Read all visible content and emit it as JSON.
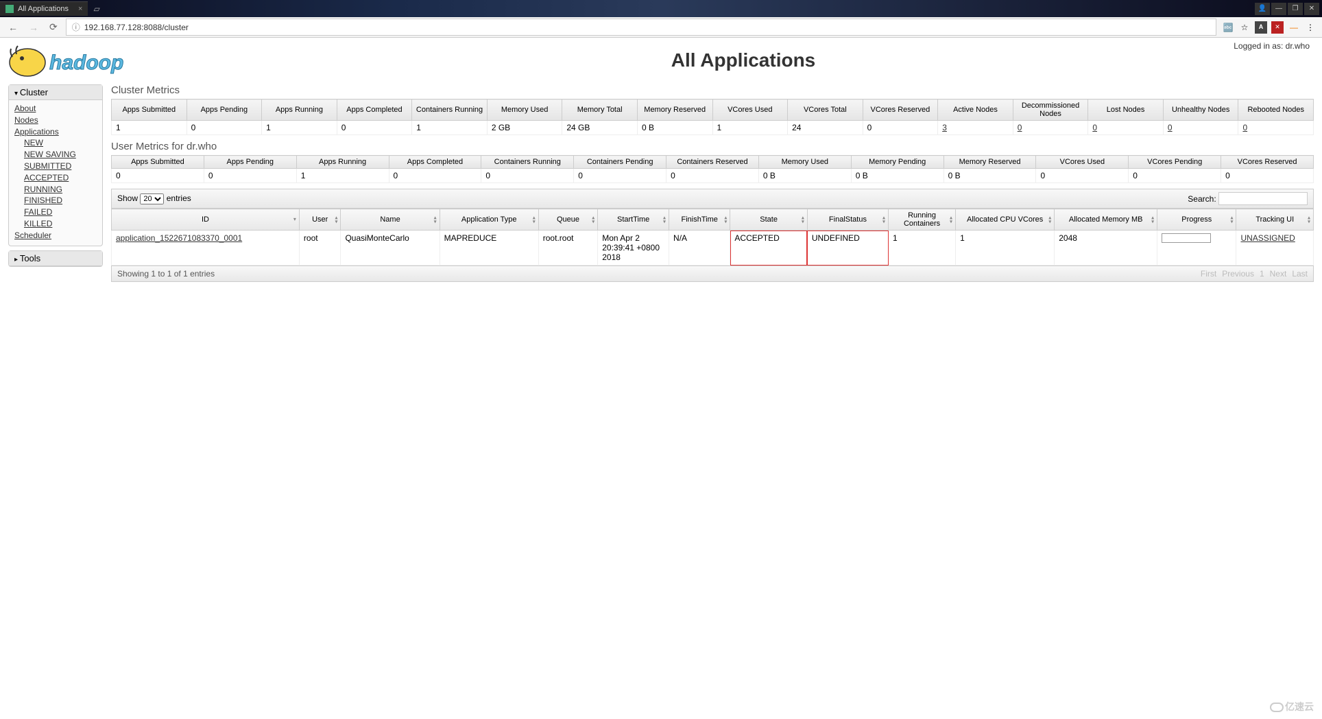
{
  "browser": {
    "tab_title": "All Applications",
    "url": "192.168.77.128:8088/cluster"
  },
  "login_info": "Logged in as: dr.who",
  "page_title": "All Applications",
  "sidebar": {
    "cluster_label": "Cluster",
    "tools_label": "Tools",
    "links": {
      "about": "About",
      "nodes": "Nodes",
      "applications": "Applications",
      "scheduler": "Scheduler"
    },
    "app_states": [
      "NEW",
      "NEW SAVING",
      "SUBMITTED",
      "ACCEPTED",
      "RUNNING",
      "FINISHED",
      "FAILED",
      "KILLED"
    ]
  },
  "cluster_metrics": {
    "title": "Cluster Metrics",
    "headers": [
      "Apps Submitted",
      "Apps Pending",
      "Apps Running",
      "Apps Completed",
      "Containers Running",
      "Memory Used",
      "Memory Total",
      "Memory Reserved",
      "VCores Used",
      "VCores Total",
      "VCores Reserved",
      "Active Nodes",
      "Decommissioned Nodes",
      "Lost Nodes",
      "Unhealthy Nodes",
      "Rebooted Nodes"
    ],
    "values": [
      "1",
      "0",
      "1",
      "0",
      "1",
      "2 GB",
      "24 GB",
      "0 B",
      "1",
      "24",
      "0",
      "3",
      "0",
      "0",
      "0",
      "0"
    ],
    "link_flags": [
      false,
      false,
      false,
      false,
      false,
      false,
      false,
      false,
      false,
      false,
      false,
      true,
      true,
      true,
      true,
      true
    ]
  },
  "user_metrics": {
    "title": "User Metrics for dr.who",
    "headers": [
      "Apps Submitted",
      "Apps Pending",
      "Apps Running",
      "Apps Completed",
      "Containers Running",
      "Containers Pending",
      "Containers Reserved",
      "Memory Used",
      "Memory Pending",
      "Memory Reserved",
      "VCores Used",
      "VCores Pending",
      "VCores Reserved"
    ],
    "values": [
      "0",
      "0",
      "1",
      "0",
      "0",
      "0",
      "0",
      "0 B",
      "0 B",
      "0 B",
      "0",
      "0",
      "0"
    ]
  },
  "datatable": {
    "show_label_pre": "Show",
    "show_label_post": "entries",
    "show_value": "20",
    "search_label": "Search:",
    "headers": [
      "ID",
      "User",
      "Name",
      "Application Type",
      "Queue",
      "StartTime",
      "FinishTime",
      "State",
      "FinalStatus",
      "Running Containers",
      "Allocated CPU VCores",
      "Allocated Memory MB",
      "Progress",
      "Tracking UI"
    ],
    "row": {
      "id": "application_1522671083370_0001",
      "user": "root",
      "name": "QuasiMonteCarlo",
      "app_type": "MAPREDUCE",
      "queue": "root.root",
      "start_time": "Mon Apr 2 20:39:41 +0800 2018",
      "finish_time": "N/A",
      "state": "ACCEPTED",
      "final_status": "UNDEFINED",
      "running_containers": "1",
      "cpu_vcores": "1",
      "memory_mb": "2048",
      "tracking_ui": "UNASSIGNED"
    },
    "footer_info": "Showing 1 to 1 of 1 entries",
    "pager": [
      "First",
      "Previous",
      "1",
      "Next",
      "Last"
    ]
  },
  "watermark": "亿速云"
}
